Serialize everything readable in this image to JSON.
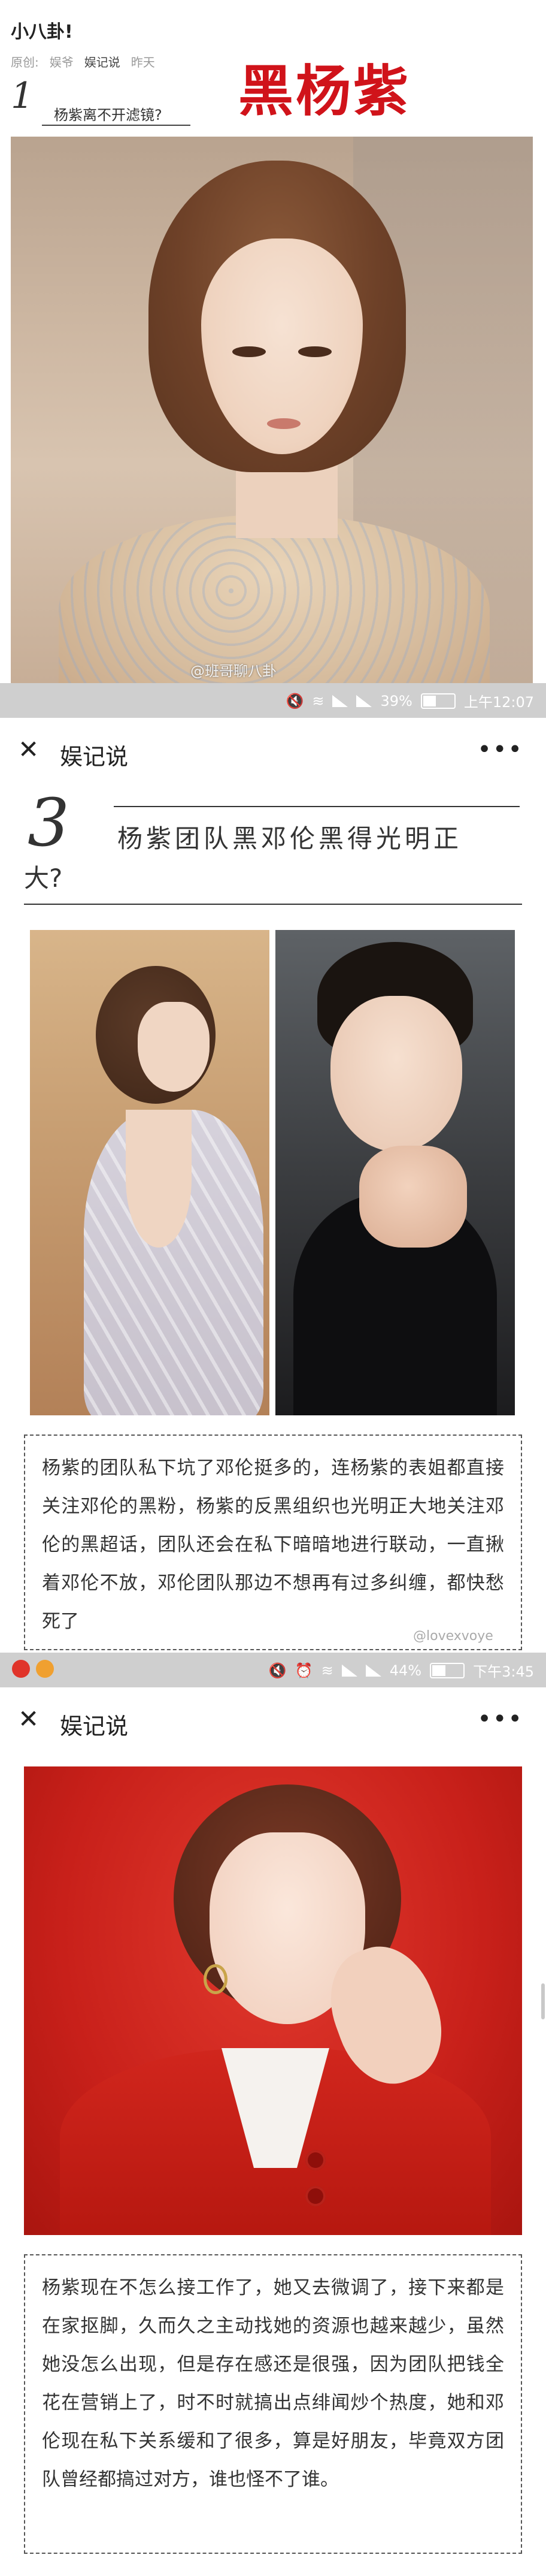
{
  "section1": {
    "intro_text": "小八卦!",
    "meta": {
      "label": "原创:",
      "channel": "娱爷",
      "author": "娱记说",
      "date": "昨天"
    },
    "headline_stamp": "黑杨紫",
    "item_number": "1",
    "item_title": "杨紫离不开滤镜?",
    "photo_watermark": "@班哥聊八卦",
    "status_bar": {
      "battery": "39%",
      "time": "上午12:07"
    }
  },
  "appbar": {
    "title": "娱记说",
    "more": "•••",
    "close": "✕"
  },
  "section2": {
    "item_number": "3",
    "title_line1": "杨紫团队黑邓伦黑得光明正",
    "title_line2": "大?",
    "paragraph": "杨紫的团队私下坑了邓伦挺多的，连杨紫的表姐都直接关注邓伦的黑粉，杨紫的反黑组织也光明正大地关注邓伦的黑超话，团队还会在私下暗暗地进行联动，一直揪着邓伦不放，邓伦团队那边不想再有过多纠缠，都快愁死了",
    "watermark": "@lovexvoye",
    "status_bar": {
      "battery": "44%",
      "time": "下午3:45"
    }
  },
  "section3": {
    "paragraph": "杨紫现在不怎么接工作了，她又去微调了，接下来都是在家抠脚，久而久之主动找她的资源也越来越少，虽然她没怎么出现，但是存在感还是很强，因为团队把钱全花在营销上了，时不时就搞出点绯闻炒个热度，她和邓伦现在私下关系缓和了很多，算是好朋友，毕竟双方团队曾经都搞过对方，谁也怪不了谁。"
  },
  "colors": {
    "stamp_red": "#d0131a",
    "status_gray": "#cfcfcf",
    "red_backdrop": "#c8201a"
  }
}
